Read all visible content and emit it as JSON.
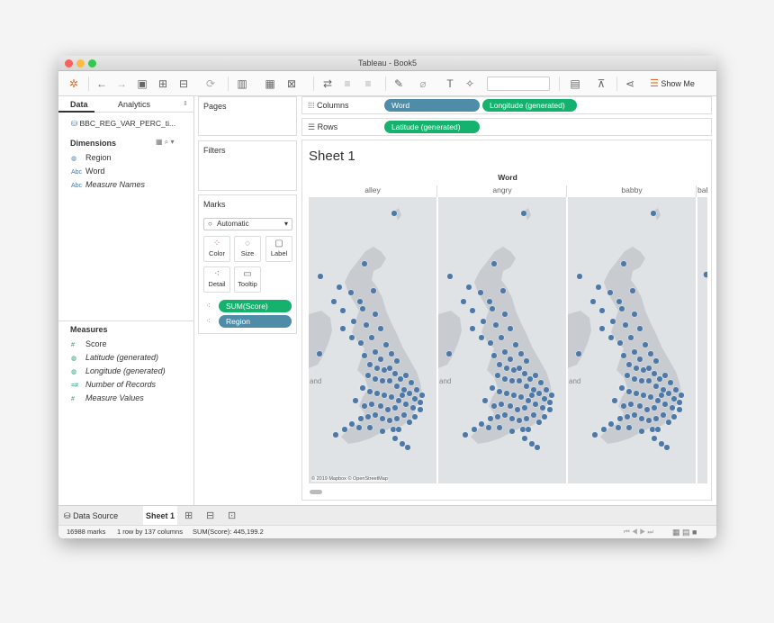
{
  "window": {
    "title": "Tableau - Book5"
  },
  "toolbar": {
    "show_me_label": "Show Me",
    "icons": [
      "tableau-logo-icon",
      "back-icon",
      "forward-icon",
      "save-icon",
      "new-datasource-icon",
      "pause-icon",
      "refresh-icon",
      "new-worksheet-icon",
      "duplicate-icon",
      "clear-icon",
      "swap-icon",
      "sort-asc-icon",
      "sort-desc-icon",
      "highlight-icon",
      "group-icon",
      "label-icon",
      "pin-icon",
      "fit-dropdown",
      "presentation-icon",
      "share-icon",
      "show-me-icon"
    ]
  },
  "data_pane": {
    "tab_data": "Data",
    "tab_analytics": "Analytics",
    "datasource_name": "BBC_REG_VAR_PERC_ti...",
    "dimensions_header": "Dimensions",
    "dimensions": [
      {
        "icon": "geo-icon",
        "label": "Region"
      },
      {
        "icon": "Abc",
        "label": "Word"
      },
      {
        "icon": "Abc",
        "label": "Measure Names"
      }
    ],
    "measures_header": "Measures",
    "measures": [
      {
        "icon": "#",
        "label": "Score"
      },
      {
        "icon": "geo-icon",
        "label": "Latitude (generated)"
      },
      {
        "icon": "geo-icon",
        "label": "Longitude (generated)"
      },
      {
        "icon": "=#",
        "label": "Number of Records"
      },
      {
        "icon": "#",
        "label": "Measure Values"
      }
    ]
  },
  "cards": {
    "pages": "Pages",
    "filters": "Filters",
    "marks": "Marks",
    "mark_type": "Automatic",
    "buttons": [
      "Color",
      "Size",
      "Label",
      "Detail",
      "Tooltip"
    ],
    "pills": [
      "SUM(Score)",
      "Region"
    ]
  },
  "shelves": {
    "columns_label": "Columns",
    "rows_label": "Rows",
    "columns_pills": [
      "Word",
      "Longitude (generated)"
    ],
    "rows_pills": [
      "Latitude (generated)"
    ]
  },
  "viz": {
    "sheet_title": "Sheet 1",
    "header": "Word",
    "columns": [
      "alley",
      "angry",
      "babby",
      "bal"
    ],
    "map_label": "and",
    "attribution": "© 2019 Mapbox © OpenStreetMap",
    "mark_color": "#4e79a7"
  },
  "bottom": {
    "data_source_tab": "Data Source",
    "sheet_tab": "Sheet 1"
  },
  "status": {
    "marks": "16988 marks",
    "dims": "1 row by 137 columns",
    "sum": "SUM(Score): 445,199.2"
  }
}
